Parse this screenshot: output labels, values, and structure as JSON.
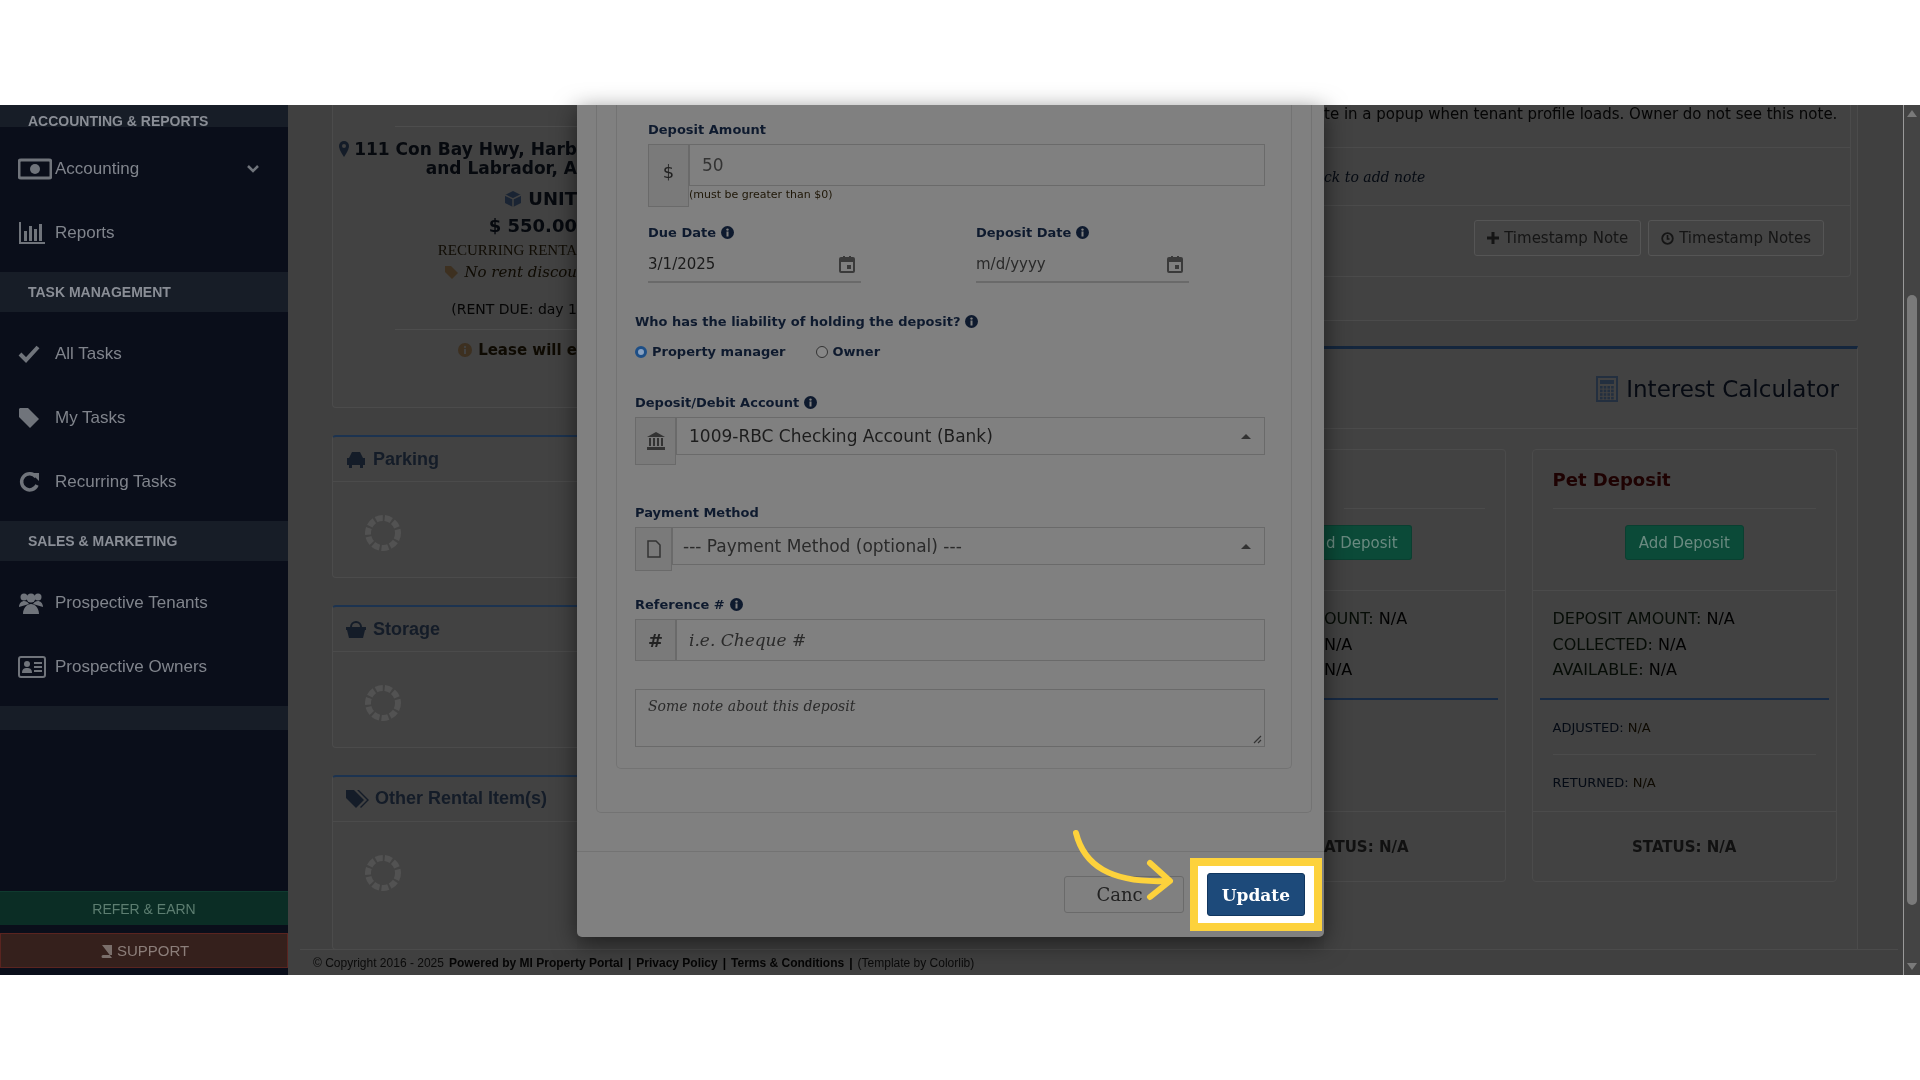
{
  "sidebar": {
    "items": [
      {
        "kind": "header",
        "label": "ACCOUNTING & REPORTS"
      },
      {
        "kind": "item",
        "label": "Accounting",
        "expanded": false
      },
      {
        "kind": "item",
        "label": "Reports"
      },
      {
        "kind": "header",
        "label": "TASK MANAGEMENT"
      },
      {
        "kind": "item",
        "label": "All Tasks"
      },
      {
        "kind": "item",
        "label": "My Tasks"
      },
      {
        "kind": "item",
        "label": "Recurring Tasks"
      },
      {
        "kind": "header",
        "label": "SALES & MARKETING"
      },
      {
        "kind": "item",
        "label": "Prospective Tenants"
      },
      {
        "kind": "item",
        "label": "Prospective Owners"
      },
      {
        "kind": "spacer"
      }
    ],
    "refer_button": "REFER & EARN",
    "support_button": "SUPPORT"
  },
  "property_card": {
    "address_lines": [
      "111 Con Bay Hwy, Harb",
      "and Labrador, A"
    ],
    "unit": "UNIT",
    "rent": "$ 550.00",
    "rent_type": "RECURRING RENTA",
    "discount": "No rent discou",
    "rent_due": "(RENT DUE: day 1",
    "lease_note": "Lease will e"
  },
  "rental_sections": [
    {
      "title": "Parking"
    },
    {
      "title": "Storage"
    },
    {
      "title": "Other Rental Item(s)"
    }
  ],
  "modal": {
    "deposit_amount": {
      "label": "Deposit Amount",
      "addon": "$",
      "value": "50",
      "hint": "(must be greater than $0)"
    },
    "due_date": {
      "label": "Due Date",
      "value": "3/1/2025"
    },
    "deposit_date": {
      "label": "Deposit Date",
      "placeholder": "m/d/yyyy"
    },
    "liability": {
      "question": "Who has the liability of holding the deposit?",
      "options": [
        {
          "label": "Property manager",
          "selected": true
        },
        {
          "label": "Owner",
          "selected": false
        }
      ]
    },
    "account": {
      "label": "Deposit/Debit Account",
      "value": "1009-RBC Checking Account (Bank)"
    },
    "payment_method": {
      "label": "Payment Method",
      "placeholder": "--- Payment Method (optional) ---"
    },
    "reference": {
      "label": "Reference #",
      "addon": "#",
      "placeholder": "i.e. Cheque #"
    },
    "note": {
      "placeholder": "Some note about this deposit"
    },
    "buttons": [
      {
        "kind": "cancel",
        "label": "Canc"
      },
      {
        "kind": "update",
        "label": "Update",
        "highlighted": true
      }
    ]
  },
  "notes_card": {
    "text": "te in a popup when tenant profile loads. Owner do not see this note.",
    "add_note": "ck to add note",
    "buttons": [
      {
        "kind": "add",
        "label": "Timestamp Note"
      },
      {
        "kind": "history",
        "label": "Timestamp Notes"
      }
    ]
  },
  "interest_calculator": {
    "title": "Interest Calculator"
  },
  "deposit_cards": [
    {
      "add_button": "d Deposit",
      "stats": [
        {
          "label": "OUNT:",
          "value": "N/A"
        },
        {
          "value": "N/A"
        },
        {
          "value": "N/A"
        }
      ],
      "status": {
        "label": "ATUS:",
        "value": "N/A"
      }
    },
    {
      "title": "Pet Deposit",
      "add_button": "Add Deposit",
      "stats": [
        {
          "label": "DEPOSIT AMOUNT:",
          "value": "N/A"
        },
        {
          "label": "COLLECTED:",
          "value": "N/A"
        },
        {
          "label": "AVAILABLE:",
          "value": "N/A"
        }
      ],
      "details": [
        {
          "label": "ADJUSTED:",
          "value": "N/A"
        },
        {
          "label": "RETURNED:",
          "value": "N/A"
        }
      ],
      "status": {
        "label": "STATUS:",
        "value": "N/A"
      }
    }
  ],
  "footer": [
    {
      "kind": "text",
      "text": "© Copyright 2016 - 2025"
    },
    {
      "kind": "link",
      "text": "Powered by MI Property Portal"
    },
    {
      "kind": "sep",
      "text": "|"
    },
    {
      "kind": "link",
      "text": "Privacy Policy"
    },
    {
      "kind": "sep",
      "text": "|"
    },
    {
      "kind": "link",
      "text": "Terms & Conditions"
    },
    {
      "kind": "sep",
      "text": "|"
    },
    {
      "kind": "note",
      "text": "(Template by Colorlib)"
    }
  ]
}
